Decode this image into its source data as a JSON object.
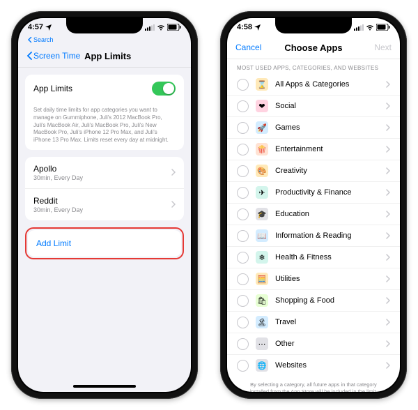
{
  "status": {
    "time_left": "4:57",
    "time_right": "4:58",
    "search_label": "Search"
  },
  "left": {
    "back_label": "Screen Time",
    "title": "App Limits",
    "toggle_row": "App Limits",
    "help_text": "Set daily time limits for app categories you want to manage on Gummiphone, Juli's 2012 MacBook Pro, Juli's MacBook Air, Juli's MacBook Pro, Juli's New MacBook Pro, Juli's iPhone 12 Pro Max, and Juli's iPhone 13 Pro Max. Limits reset every day at midnight.",
    "limits": [
      {
        "name": "Apollo",
        "detail": "30min, Every Day"
      },
      {
        "name": "Reddit",
        "detail": "30min, Every Day"
      }
    ],
    "add_limit": "Add Limit"
  },
  "right": {
    "cancel": "Cancel",
    "title": "Choose Apps",
    "next": "Next",
    "section_header": "MOST USED APPS, CATEGORIES, AND WEBSITES",
    "categories": [
      {
        "label": "All Apps & Categories",
        "icon": "⌛",
        "bg": "#ffe9b8"
      },
      {
        "label": "Social",
        "icon": "❤",
        "bg": "#ffd3e1"
      },
      {
        "label": "Games",
        "icon": "🚀",
        "bg": "#d3ecff"
      },
      {
        "label": "Entertainment",
        "icon": "🍿",
        "bg": "#ffe2d3"
      },
      {
        "label": "Creativity",
        "icon": "🎨",
        "bg": "#ffe9b8"
      },
      {
        "label": "Productivity & Finance",
        "icon": "✈",
        "bg": "#d3f5ec"
      },
      {
        "label": "Education",
        "icon": "🎓",
        "bg": "#e1e1e6"
      },
      {
        "label": "Information & Reading",
        "icon": "📖",
        "bg": "#d3ecff"
      },
      {
        "label": "Health & Fitness",
        "icon": "❄",
        "bg": "#d3f5ec"
      },
      {
        "label": "Utilities",
        "icon": "🧮",
        "bg": "#ffe9b8"
      },
      {
        "label": "Shopping & Food",
        "icon": "🛍",
        "bg": "#e7ffd3"
      },
      {
        "label": "Travel",
        "icon": "🏝",
        "bg": "#d3ecff"
      },
      {
        "label": "Other",
        "icon": "⋯",
        "bg": "#e1e1e6"
      },
      {
        "label": "Websites",
        "icon": "🌐",
        "bg": "#e1e1e6"
      }
    ],
    "footnote": "By selecting a category, all future apps in that category installed from the App Store will be included in the limit."
  }
}
